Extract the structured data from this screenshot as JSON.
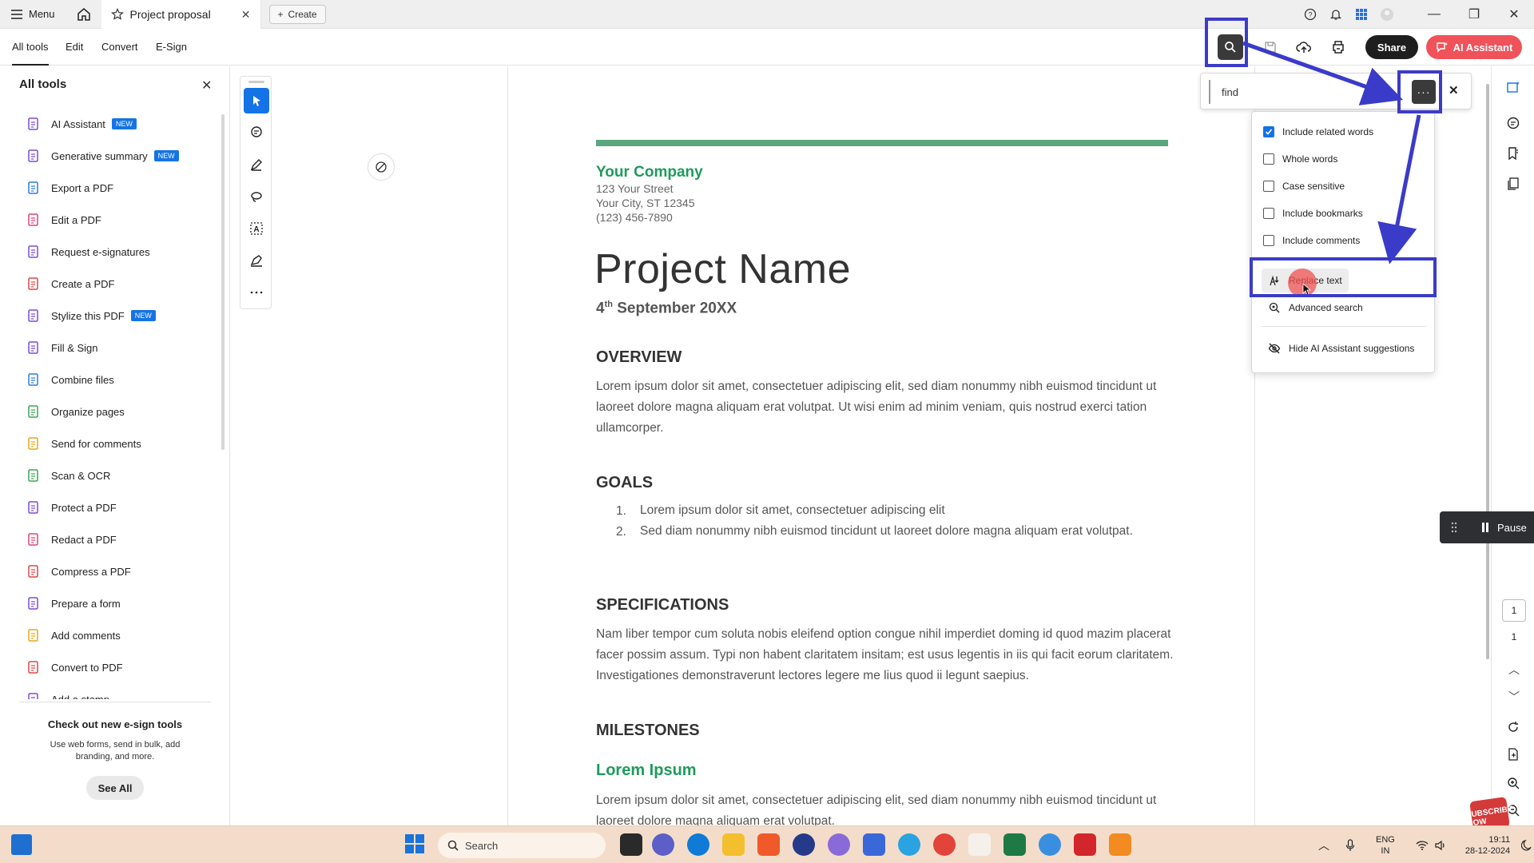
{
  "titlebar": {
    "menu_label": "Menu",
    "tab_title": "Project proposal",
    "create_label": "Create"
  },
  "toolbar": {
    "tabs": [
      "All tools",
      "Edit",
      "Convert",
      "E-Sign"
    ],
    "share_label": "Share",
    "ai_label": "AI Assistant"
  },
  "left_panel": {
    "title": "All tools",
    "items": [
      {
        "label": "AI Assistant",
        "badge": "NEW",
        "icon": "ai-assistant-icon",
        "color": "#7b4dd6"
      },
      {
        "label": "Generative summary",
        "badge": "NEW",
        "icon": "generative-summary-icon",
        "color": "#7b4dd6"
      },
      {
        "label": "Export a PDF",
        "badge": "",
        "icon": "export-pdf-icon",
        "color": "#2c7be5"
      },
      {
        "label": "Edit a PDF",
        "badge": "",
        "icon": "edit-pdf-icon",
        "color": "#e0457b"
      },
      {
        "label": "Request e-signatures",
        "badge": "",
        "icon": "request-signatures-icon",
        "color": "#7b4dd6"
      },
      {
        "label": "Create a PDF",
        "badge": "",
        "icon": "create-pdf-icon",
        "color": "#e04646"
      },
      {
        "label": "Stylize this PDF",
        "badge": "NEW",
        "icon": "stylize-pdf-icon",
        "color": "#7b4dd6"
      },
      {
        "label": "Fill & Sign",
        "badge": "",
        "icon": "fill-sign-icon",
        "color": "#7b4dd6"
      },
      {
        "label": "Combine files",
        "badge": "",
        "icon": "combine-files-icon",
        "color": "#2c7be5"
      },
      {
        "label": "Organize pages",
        "badge": "",
        "icon": "organize-pages-icon",
        "color": "#3aa655"
      },
      {
        "label": "Send for comments",
        "badge": "",
        "icon": "send-comments-icon",
        "color": "#e6a817"
      },
      {
        "label": "Scan & OCR",
        "badge": "",
        "icon": "scan-ocr-icon",
        "color": "#3aa655"
      },
      {
        "label": "Protect a PDF",
        "badge": "",
        "icon": "protect-pdf-icon",
        "color": "#7b4dd6"
      },
      {
        "label": "Redact a PDF",
        "badge": "",
        "icon": "redact-pdf-icon",
        "color": "#e0457b"
      },
      {
        "label": "Compress a PDF",
        "badge": "",
        "icon": "compress-pdf-icon",
        "color": "#e04646"
      },
      {
        "label": "Prepare a form",
        "badge": "",
        "icon": "prepare-form-icon",
        "color": "#7b4dd6"
      },
      {
        "label": "Add comments",
        "badge": "",
        "icon": "add-comments-icon",
        "color": "#e6a817"
      },
      {
        "label": "Convert to PDF",
        "badge": "",
        "icon": "convert-pdf-icon",
        "color": "#e04646"
      },
      {
        "label": "Add a stamp",
        "badge": "",
        "icon": "add-stamp-icon",
        "color": "#7b4dd6"
      }
    ],
    "promo_title": "Check out new e-sign tools",
    "promo_text": "Use web forms, send in bulk, add branding, and more.",
    "see_all_label": "See All"
  },
  "document": {
    "company": "Your Company",
    "address_lines": [
      "123 Your Street",
      "Your City, ST 12345",
      "(123) 456-7890"
    ],
    "project_name": "Project Name",
    "date_day": "4",
    "date_sup": "th",
    "date_rest": " September 20XX",
    "overview_heading": "OVERVIEW",
    "overview_text": "Lorem ipsum dolor sit amet, consectetuer adipiscing elit, sed diam nonummy nibh euismod tincidunt ut laoreet dolore magna aliquam erat volutpat. Ut wisi enim ad minim veniam, quis nostrud exerci tation ullamcorper.",
    "goals_heading": "GOALS",
    "goals": [
      {
        "num": "1.",
        "text": "Lorem ipsum dolor sit amet, consectetuer adipiscing elit"
      },
      {
        "num": "2.",
        "text": "Sed diam nonummy nibh euismod tincidunt ut laoreet dolore magna aliquam erat volutpat."
      }
    ],
    "specs_heading": "SPECIFICATIONS",
    "specs_text": "Nam liber tempor cum soluta nobis eleifend option congue nihil imperdiet doming id quod mazim placerat facer possim assum. Typi non habent claritatem insitam; est usus legentis in iis qui facit eorum claritatem. Investigationes demonstraverunt lectores legere me lius quod ii legunt saepius.",
    "milestones_heading": "MILESTONES",
    "milestone_sub": "Lorem Ipsum",
    "milestone_text": "Lorem ipsum dolor sit amet, consectetuer adipiscing elit, sed diam nonummy nibh euismod tincidunt ut laoreet dolore magna aliquam erat volutpat."
  },
  "find": {
    "value": "find",
    "more_label": "···",
    "options": [
      {
        "label": "Include related words",
        "checked": true
      },
      {
        "label": "Whole words",
        "checked": false
      },
      {
        "label": "Case sensitive",
        "checked": false
      },
      {
        "label": "Include bookmarks",
        "checked": false
      },
      {
        "label": "Include comments",
        "checked": false
      }
    ],
    "actions": [
      "Replace text",
      "Advanced search",
      "Hide AI Assistant suggestions"
    ]
  },
  "right_rail": {
    "pause_label": "Pause",
    "page_current": "1",
    "page_total": "1"
  },
  "subscribe_badge": "SUBSCRIBE NOW",
  "taskbar": {
    "search_label": "Search",
    "lang_line1": "ENG",
    "lang_line2": "IN",
    "time": "19:11",
    "date": "28-12-2024"
  },
  "colors": {
    "accent_blue": "#1473e6",
    "annotation": "#3b3bc9",
    "company_green": "#1f9b5c",
    "ai_button": "#f0525a"
  }
}
